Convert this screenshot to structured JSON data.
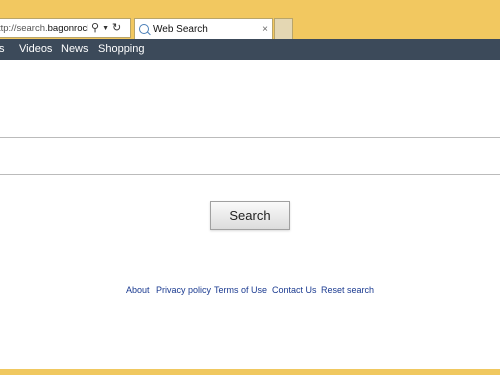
{
  "browser": {
    "url_prefix": "ttp://search.",
    "url_domain": "bagonrock....",
    "tab_title": "Web Search",
    "tab_close": "×"
  },
  "nav": {
    "items": [
      "s",
      "Videos",
      "News",
      "Shopping"
    ]
  },
  "search": {
    "input_value": "",
    "button_label": "Search"
  },
  "footer": {
    "links": [
      "About",
      "Privacy policy",
      "Terms of Use",
      "Contact Us",
      "Reset search"
    ]
  },
  "colors": {
    "frame": "#f0c860",
    "navbar": "#3c4a5a",
    "link": "#1a3a90"
  }
}
